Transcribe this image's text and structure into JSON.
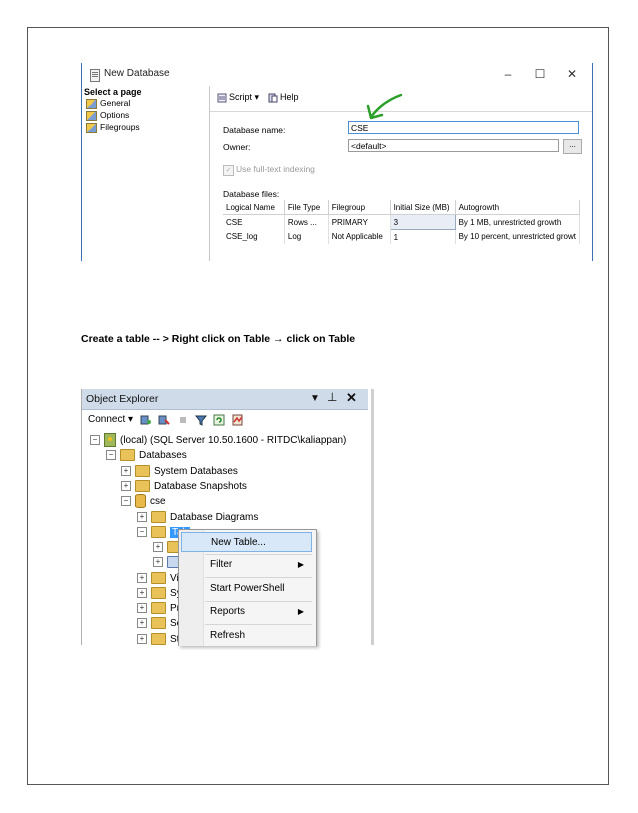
{
  "new_database": {
    "title": "New Database",
    "minimize": "–",
    "maximize": "☐",
    "close": "✕",
    "select_page_header": "Select a page",
    "pages": [
      "General",
      "Options",
      "Filegroups"
    ],
    "toolbar": {
      "script": "Script",
      "help": "Help"
    },
    "database_name_label": "Database name:",
    "database_name_value": "CSE",
    "owner_label": "Owner:",
    "owner_value": "<default>",
    "ellipsis": "...",
    "fulltext_label": "Use full-text indexing",
    "files_label": "Database files:",
    "files_columns": [
      "Logical Name",
      "File Type",
      "Filegroup",
      "Initial Size (MB)",
      "Autogrowth"
    ],
    "files_rows": [
      [
        "CSE",
        "Rows ...",
        "PRIMARY",
        "3",
        "By 1 MB, unrestricted growth"
      ],
      [
        "CSE_log",
        "Log",
        "Not Applicable",
        "1",
        "By 10 percent, unrestricted growt"
      ]
    ]
  },
  "instruction": "Create a table -- > Right click on Table  → click on Table",
  "object_explorer": {
    "title": "Object Explorer",
    "pin": "—̧",
    "close": "✕",
    "connect": "Connect ▾",
    "server": "(local) (SQL Server 10.50.1600 - RITDC\\kaliappan)",
    "databases": "Databases",
    "system_databases": "System Databases",
    "database_snapshots": "Database Snapshots",
    "cse": "cse",
    "database_diagrams": "Database Diagrams",
    "tables_partial": "Tab",
    "partial_items": [
      "Vie",
      "Sy",
      "Pro",
      "Ser",
      "Sto"
    ]
  },
  "context_menu": {
    "items": [
      "New Table...",
      "Filter",
      "Start PowerShell",
      "Reports",
      "Refresh"
    ]
  },
  "colors": {
    "annotation_arrow": "#2aa02a",
    "oe_header": "#cfdbe9",
    "selection": "#3399ff"
  }
}
